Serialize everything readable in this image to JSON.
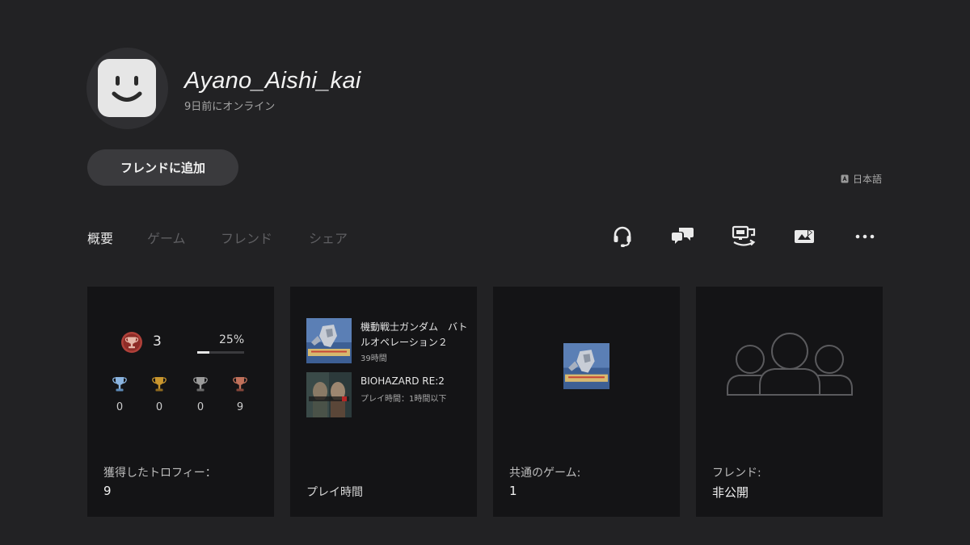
{
  "profile": {
    "username": "Ayano_Aishi_kai",
    "online_status": "9日前にオンライン",
    "add_friend_label": "フレンドに追加",
    "language": "日本語"
  },
  "tabs": [
    {
      "label": "概要",
      "active": true
    },
    {
      "label": "ゲーム",
      "active": false
    },
    {
      "label": "フレンド",
      "active": false
    },
    {
      "label": "シェア",
      "active": false
    }
  ],
  "actions": [
    "headset-icon",
    "chat-icon",
    "remote-play-icon",
    "share-screen-icon",
    "more-icon"
  ],
  "trophies": {
    "level": "3",
    "progress_label": "25%",
    "progress": 0.25,
    "counts": [
      {
        "type": "platinum",
        "value": "0"
      },
      {
        "type": "gold",
        "value": "0"
      },
      {
        "type": "silver",
        "value": "0"
      },
      {
        "type": "bronze",
        "value": "9"
      }
    ],
    "label": "獲得したトロフィー：",
    "value": "9"
  },
  "playtime": {
    "games": [
      {
        "title": "機動戦士ガンダム　バトルオペレーション２",
        "subtitle": "39時間"
      },
      {
        "title": "BIOHAZARD RE:2",
        "subtitle": "プレイ時間：1時間以下"
      }
    ],
    "label": "プレイ時間"
  },
  "shared_games": {
    "label": "共通のゲーム:",
    "value": "1"
  },
  "friends": {
    "label": "フレンド:",
    "value": "非公開"
  },
  "colors": {
    "background": "#222224",
    "card": "#141416",
    "platinum": "#8ab4e0",
    "gold": "#c9962e",
    "silver": "#9a9a9a",
    "bronze": "#c0705a",
    "level_badge": "#b0413a"
  }
}
